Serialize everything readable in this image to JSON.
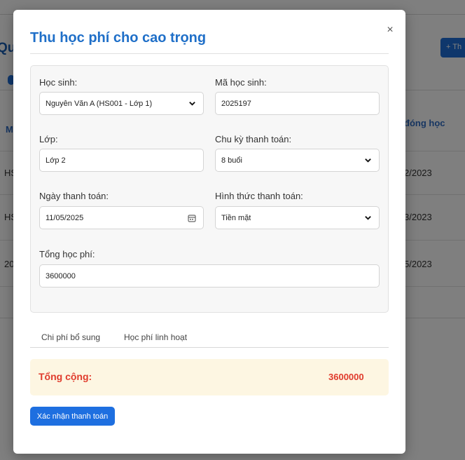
{
  "background": {
    "page_title": "Qu",
    "add_button_label": "+ Th",
    "table_header_left": "M",
    "table_header_right": "đóng học",
    "rows": [
      {
        "left": "HS",
        "right": "2/2023"
      },
      {
        "left": "HS",
        "right": "3/2023"
      },
      {
        "left": "20",
        "right": "5/2023"
      }
    ]
  },
  "modal": {
    "title": "Thu học phí cho cao trọng",
    "close_label": "×",
    "form": {
      "student_label": "Học sinh:",
      "student_value": "Nguyễn Văn A (HS001 - Lớp 1)",
      "student_code_label": "Mã học sinh:",
      "student_code_value": "2025197",
      "class_label": "Lớp:",
      "class_value": "Lớp 2",
      "cycle_label": "Chu kỳ thanh toán:",
      "cycle_value": "8 buổi",
      "date_label": "Ngày thanh toán:",
      "date_value": "11/05/2025",
      "method_label": "Hình thức thanh toán:",
      "method_value": "Tiền mặt",
      "fee_label": "Tổng học phí:",
      "fee_value": "3600000"
    },
    "tabs": [
      {
        "label": "Chi phí bổ sung"
      },
      {
        "label": "Học phí linh hoạt"
      }
    ],
    "total": {
      "label": "Tổng cộng:",
      "value": "3600000"
    },
    "confirm_label": "Xác nhận thanh toán"
  },
  "colors": {
    "accent": "#1f6fc8",
    "button": "#1e6fe0",
    "total_text": "#e03b2c",
    "total_bg": "#fdf6e2"
  },
  "icons": {
    "close": "close-icon",
    "dropdown": "chevron-down-icon",
    "date": "calendar-icon"
  }
}
